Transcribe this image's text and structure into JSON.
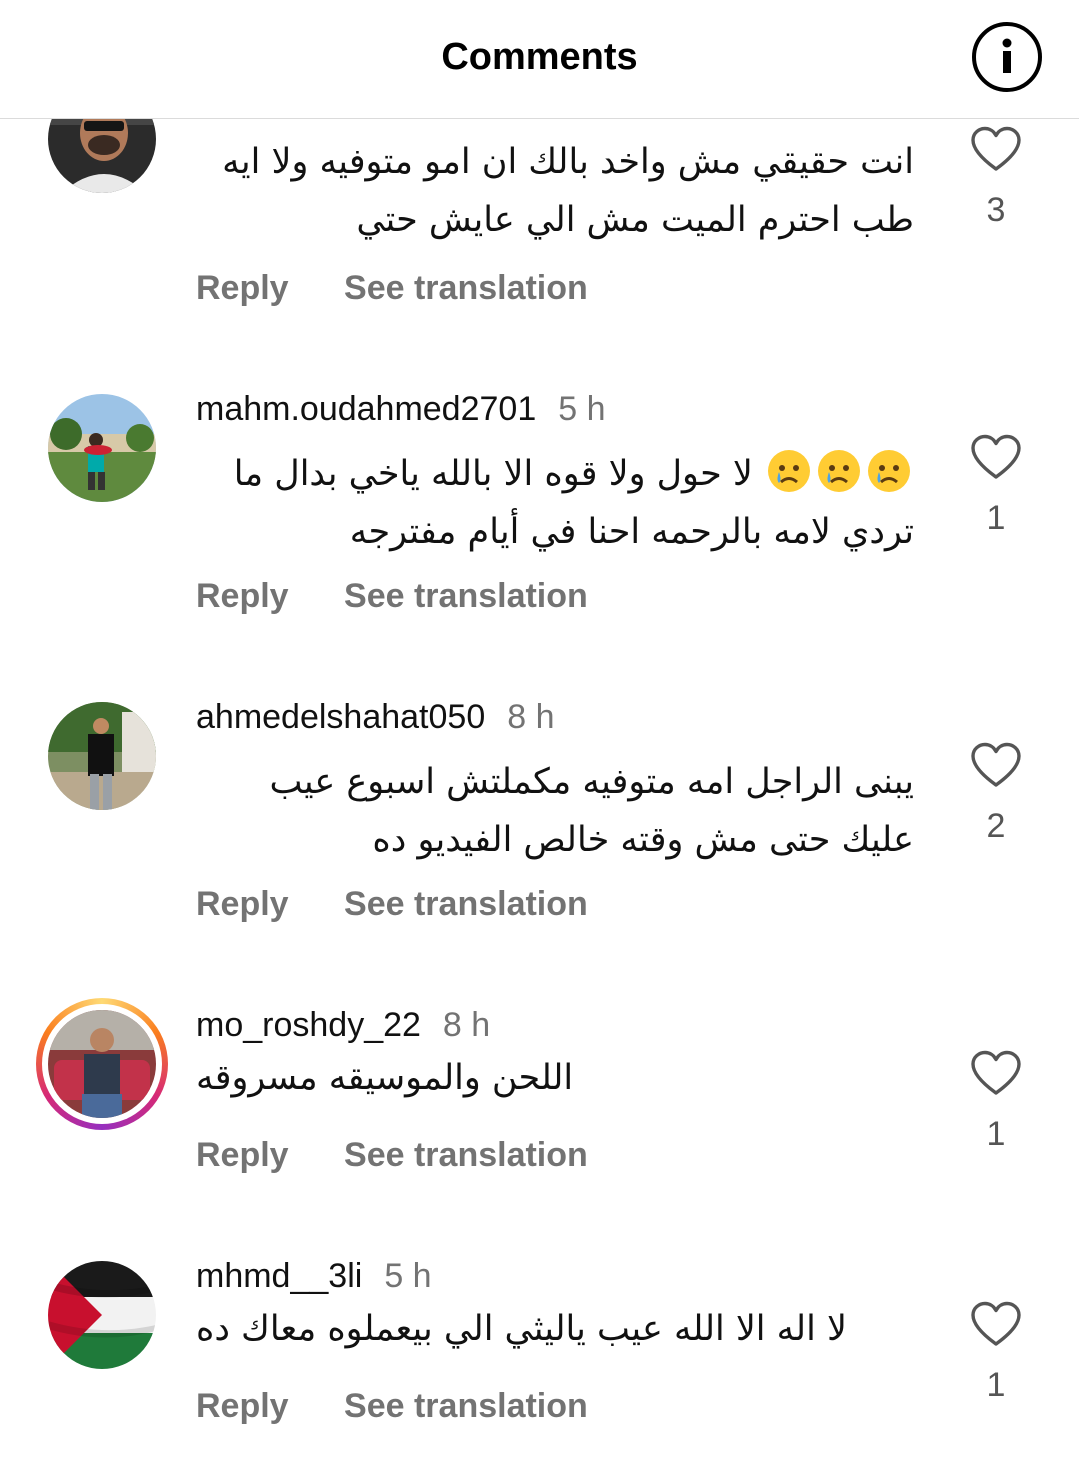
{
  "header": {
    "title": "Comments",
    "info_icon": "info-circle-icon"
  },
  "actions": {
    "reply": "Reply",
    "see_translation": "See translation"
  },
  "comments": [
    {
      "username": "",
      "time": "",
      "text": "انت حقيقي مش واخد بالك ان امو متوفيه ولا ايه طب  احترم الميت مش الي عايش حتي",
      "likes": "3"
    },
    {
      "username": "mahm.oudahmed2701",
      "time": "5 h",
      "text": "لا حول ولا قوه الا بالله ياخي بدال ما تردي لامه بالرحمه احنا في أيام مفترجه",
      "emoji": [
        "crying-face",
        "crying-face",
        "crying-face"
      ],
      "likes": "1"
    },
    {
      "username": "ahmedelshahat050",
      "time": "8 h",
      "text": "يبنى الراجل امه متوفيه مكملتش اسبوع عيب عليك حتى مش وقته خالص الفيديو ده",
      "likes": "2"
    },
    {
      "username": "mo_roshdy_22",
      "time": "8 h",
      "text": "اللحن والموسيقه مسروقه",
      "likes": "1",
      "has_story": true
    },
    {
      "username": "mhmd__3li",
      "time": "5 h",
      "text": "لا اله الا الله عيب ياليثي الي بيعملوه معاك ده",
      "likes": "1"
    }
  ],
  "colors": {
    "muted": "#737373",
    "divider": "#dbdbdb",
    "text": "#111111"
  }
}
